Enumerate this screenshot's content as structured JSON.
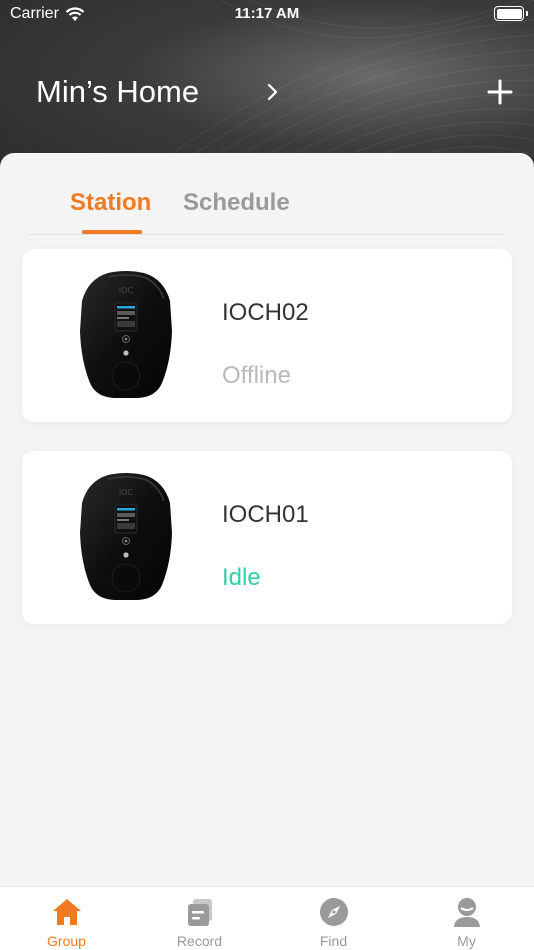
{
  "status_bar": {
    "carrier": "Carrier",
    "time": "11:17 AM"
  },
  "header": {
    "title": "Min’s Home"
  },
  "tabs": [
    {
      "label": "Station",
      "active": true
    },
    {
      "label": "Schedule",
      "active": false
    }
  ],
  "stations": [
    {
      "name": "IOCH02",
      "status": "Offline"
    },
    {
      "name": "IOCH01",
      "status": "Idle"
    }
  ],
  "tab_bar": [
    {
      "label": "Group",
      "icon": "home-icon",
      "active": true
    },
    {
      "label": "Record",
      "icon": "record-icon",
      "active": false
    },
    {
      "label": "Find",
      "icon": "compass-icon",
      "active": false
    },
    {
      "label": "My",
      "icon": "user-icon",
      "active": false
    }
  ],
  "colors": {
    "accent": "#f07b22",
    "idle": "#2fcfa8",
    "offline": "#b9b9b9",
    "inactive": "#9a9a9a"
  }
}
